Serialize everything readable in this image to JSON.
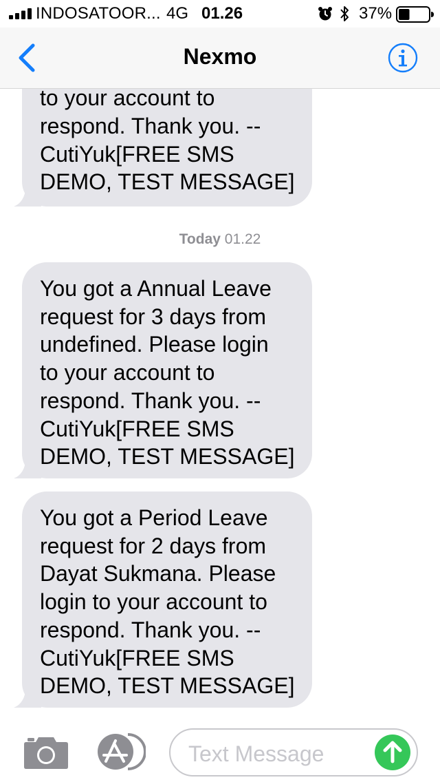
{
  "status_bar": {
    "carrier": "INDOSATOOR...",
    "network": "4G",
    "time": "01.26",
    "battery_percent": "37%",
    "battery_level": 0.37,
    "icons": [
      "signal-icon",
      "alarm-icon",
      "bluetooth-icon",
      "battery-icon"
    ]
  },
  "nav": {
    "title": "Nexmo",
    "back_icon": "chevron-left-icon",
    "info_icon": "info-icon",
    "accent_color": "#147efb"
  },
  "messages": {
    "bubble_color": "#e5e5ea",
    "timestamp": {
      "day": "Today",
      "time": "01.22"
    },
    "items": [
      {
        "lines": [
          "to your account to",
          "respond. Thank you. --",
          "CutiYuk[FREE SMS",
          "DEMO, TEST MESSAGE]"
        ]
      },
      {
        "lines": [
          "You got a Annual Leave",
          "request for 3 days from",
          "undefined. Please login",
          "to your account to",
          "respond. Thank you. --",
          "CutiYuk[FREE SMS",
          "DEMO, TEST MESSAGE]"
        ]
      },
      {
        "lines": [
          "You got a Period Leave",
          "request for 2 days from",
          "Dayat Sukmana. Please",
          "login to your account to",
          "respond. Thank you. --",
          "CutiYuk[FREE SMS",
          "DEMO, TEST MESSAGE]"
        ]
      }
    ]
  },
  "input_bar": {
    "placeholder": "Text Message",
    "camera_icon": "camera-icon",
    "appstore_icon": "app-store-icon",
    "send_icon": "send-arrow-up-icon",
    "send_color": "#35c759"
  }
}
